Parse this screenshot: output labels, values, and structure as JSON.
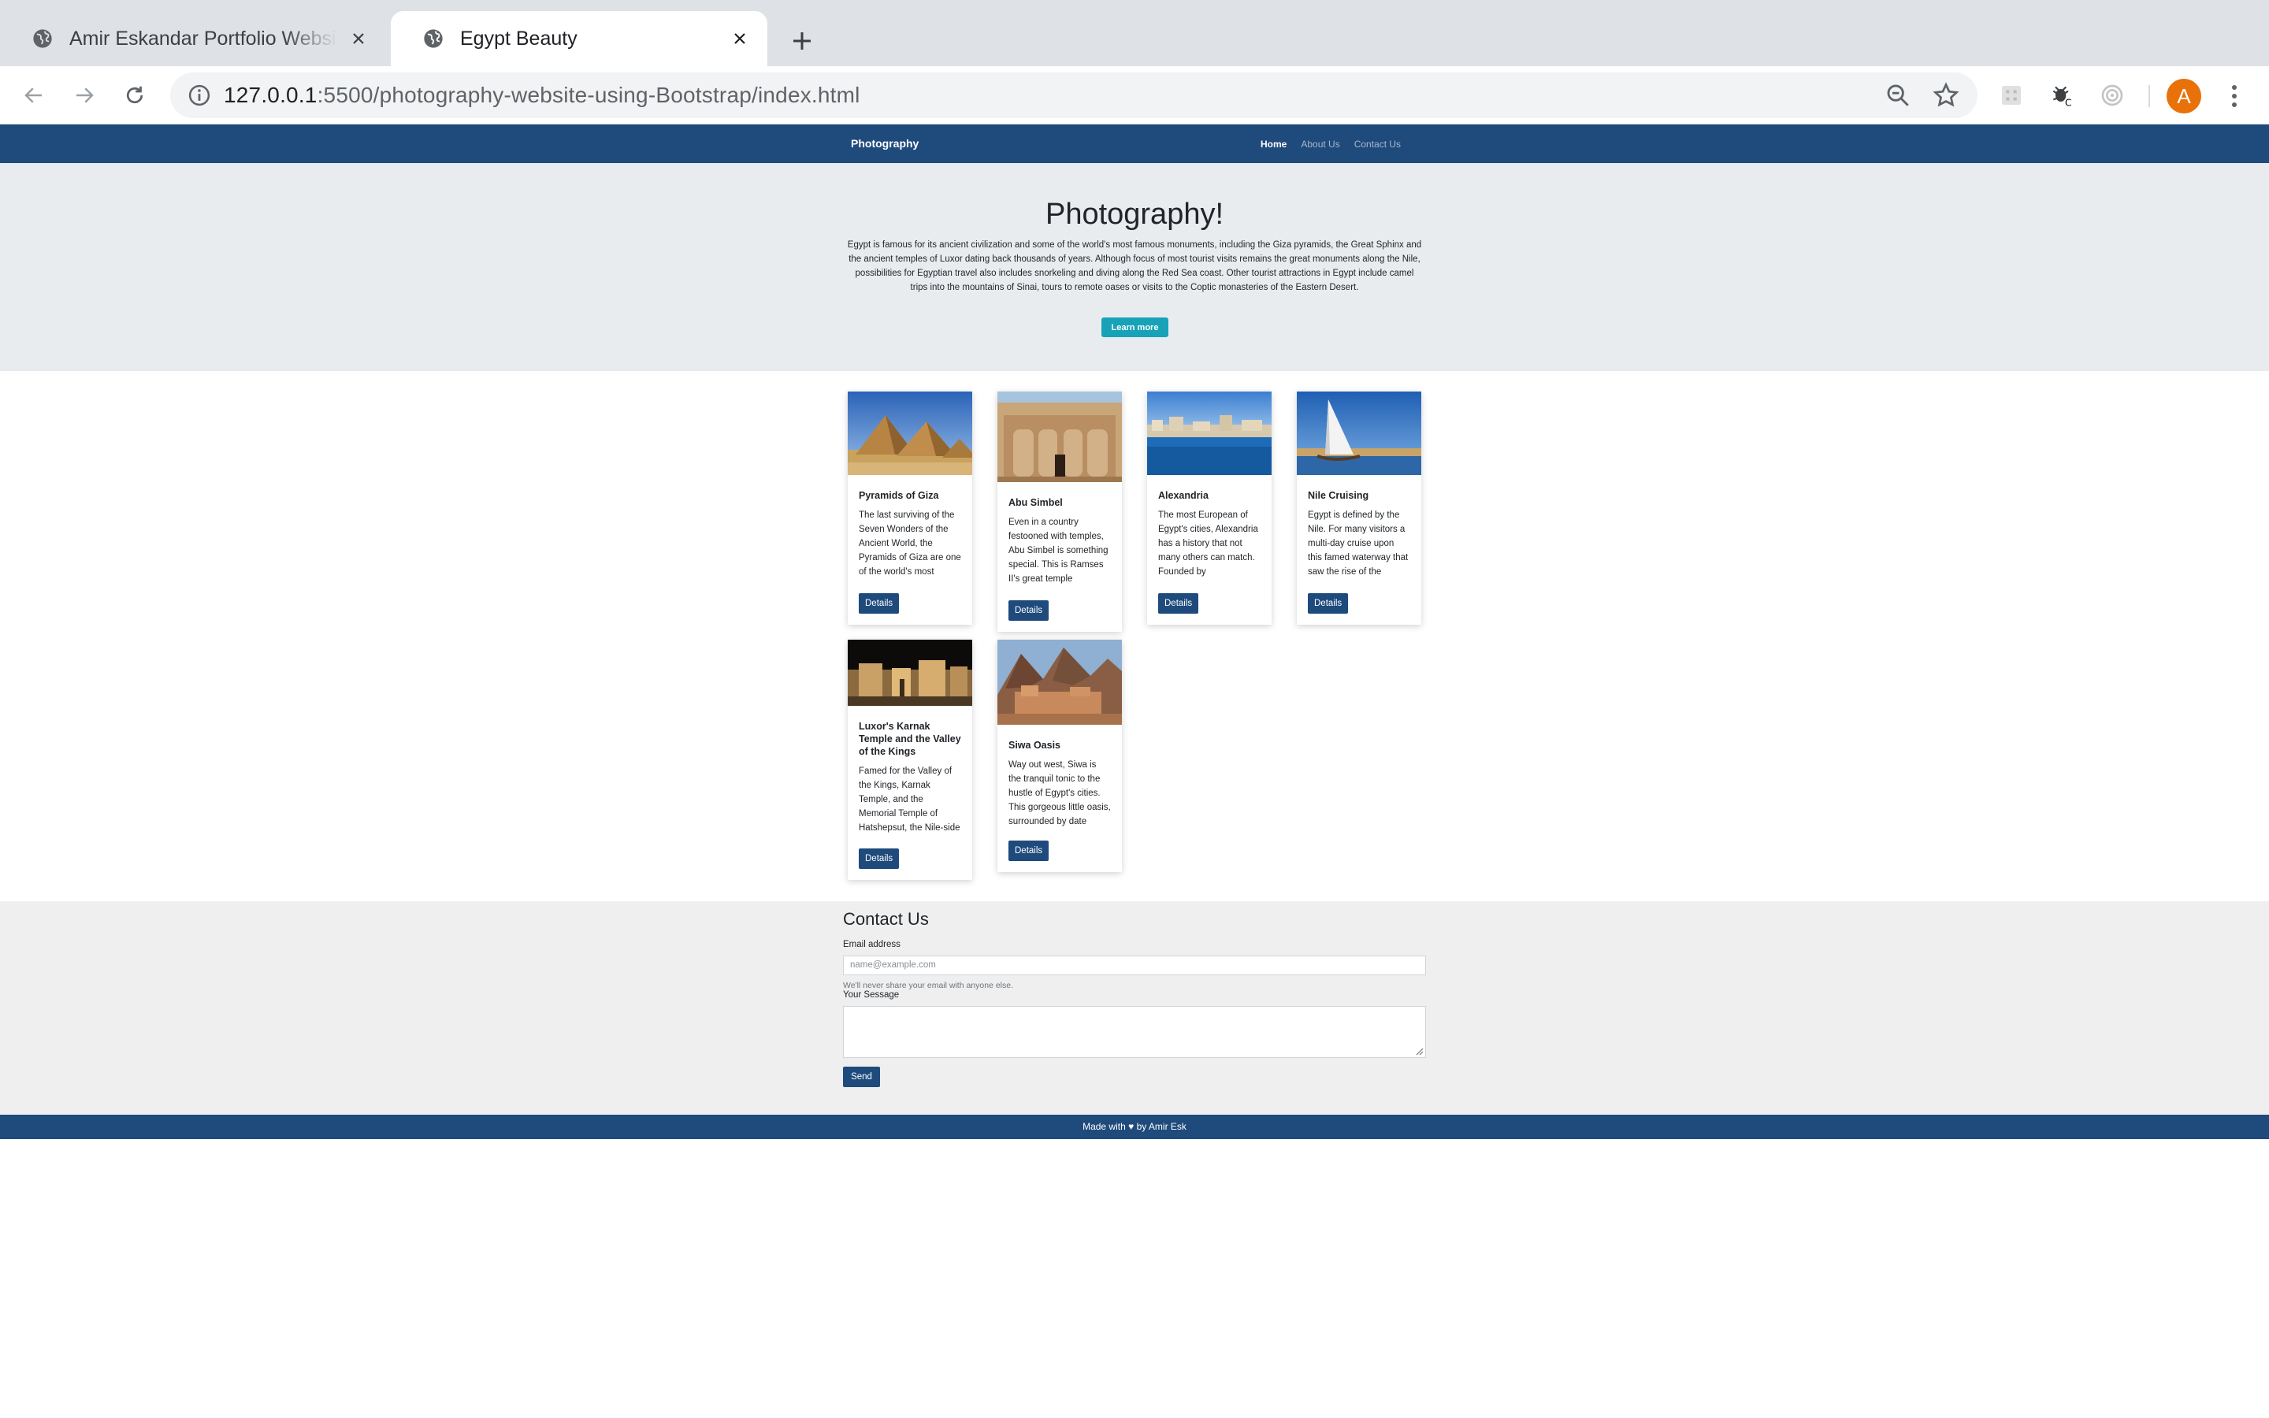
{
  "browser": {
    "tabs": [
      {
        "title": "Amir Eskandar Portfolio Website",
        "active": false
      },
      {
        "title": "Egypt Beauty",
        "active": true
      }
    ],
    "url_host": "127.0.0.1",
    "url_rest": ":5500/photography-website-using-Bootstrap/index.html",
    "avatar_letter": "A"
  },
  "navbar": {
    "brand": "Photography",
    "links": [
      {
        "label": "Home",
        "active": true
      },
      {
        "label": "About Us",
        "active": false
      },
      {
        "label": "Contact Us",
        "active": false
      }
    ]
  },
  "hero": {
    "title": "Photography!",
    "text": "Egypt is famous for its ancient civilization and some of the world's most famous monuments, including the Giza pyramids, the Great Sphinx and the ancient temples of Luxor dating back thousands of years. Although focus of most tourist visits remains the great monuments along the Nile, possibilities for Egyptian travel also includes snorkeling and diving along the Red Sea coast. Other tourist attractions in Egypt include camel trips into the mountains of Sinai, tours to remote oases or visits to the Coptic monasteries of the Eastern Desert.",
    "button": "Learn more"
  },
  "cards": [
    {
      "title": "Pyramids of Giza",
      "text": "The last surviving of the Seven Wonders of the Ancient World, the Pyramids of Giza are one of the world's most",
      "button": "Details"
    },
    {
      "title": "Abu Simbel",
      "text": "Even in a country festooned with temples, Abu Simbel is something special. This is Ramses II's great temple",
      "button": "Details"
    },
    {
      "title": "Alexandria",
      "text": "The most European of Egypt's cities, Alexandria has a history that not many others can match. Founded by",
      "button": "Details"
    },
    {
      "title": "Nile Cruising",
      "text": "Egypt is defined by the Nile. For many visitors a multi-day cruise upon this famed waterway that saw the rise of the",
      "button": "Details"
    },
    {
      "title": "Luxor's Karnak Temple and the Valley of the Kings",
      "text": "Famed for the Valley of the Kings, Karnak Temple, and the Memorial Temple of Hatshepsut, the Nile-side town of Luxor in",
      "button": "Details"
    },
    {
      "title": "Siwa Oasis",
      "text": "Way out west, Siwa is the tranquil tonic to the hustle of Egypt's cities. This gorgeous little oasis, surrounded by date",
      "button": "Details"
    }
  ],
  "contact": {
    "heading": "Contact Us",
    "email_label": "Email address",
    "email_placeholder": "name@example.com",
    "email_help": "We'll never share your email with anyone else.",
    "message_label": "Your Sessage",
    "send": "Send"
  },
  "footer": {
    "text": "Made with ♥ by Amir Esk"
  }
}
